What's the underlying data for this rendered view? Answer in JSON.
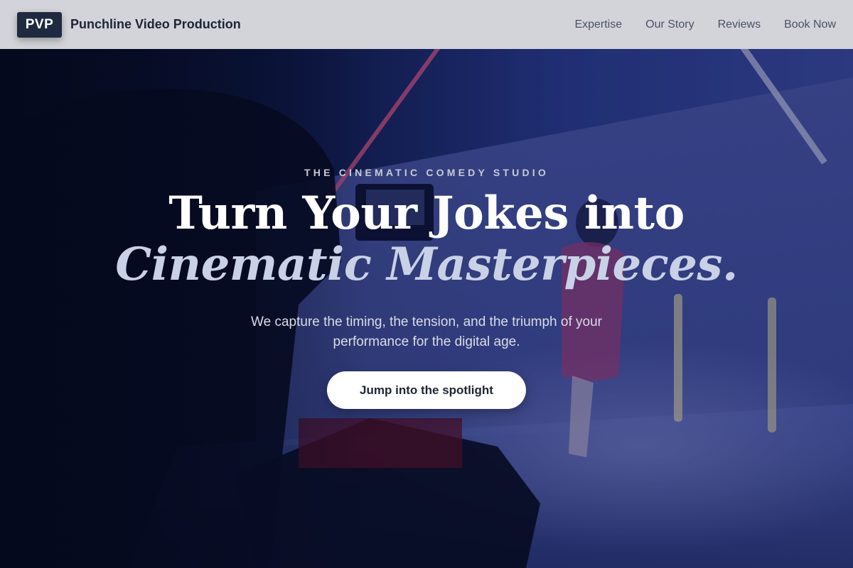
{
  "header": {
    "logo": "PVP",
    "brand_name": "Punchline Video Production",
    "nav": [
      {
        "label": "Expertise"
      },
      {
        "label": "Our Story"
      },
      {
        "label": "Reviews"
      },
      {
        "label": "Book Now"
      }
    ]
  },
  "hero": {
    "eyebrow": "THE CINEMATIC COMEDY STUDIO",
    "headline_line1": "Turn Your Jokes into",
    "headline_line2": "Cinematic Masterpieces.",
    "subtitle": "We capture the timing, the tension, and the triumph of your performance for the digital age.",
    "cta_label": "Jump into the spotlight"
  },
  "colors": {
    "header_bg": "#d2d4d9",
    "logo_bg": "#1f2a40",
    "hero_overlay": "#0b1230",
    "accent_italic": "#c9d1e6",
    "cta_bg": "#ffffff"
  }
}
